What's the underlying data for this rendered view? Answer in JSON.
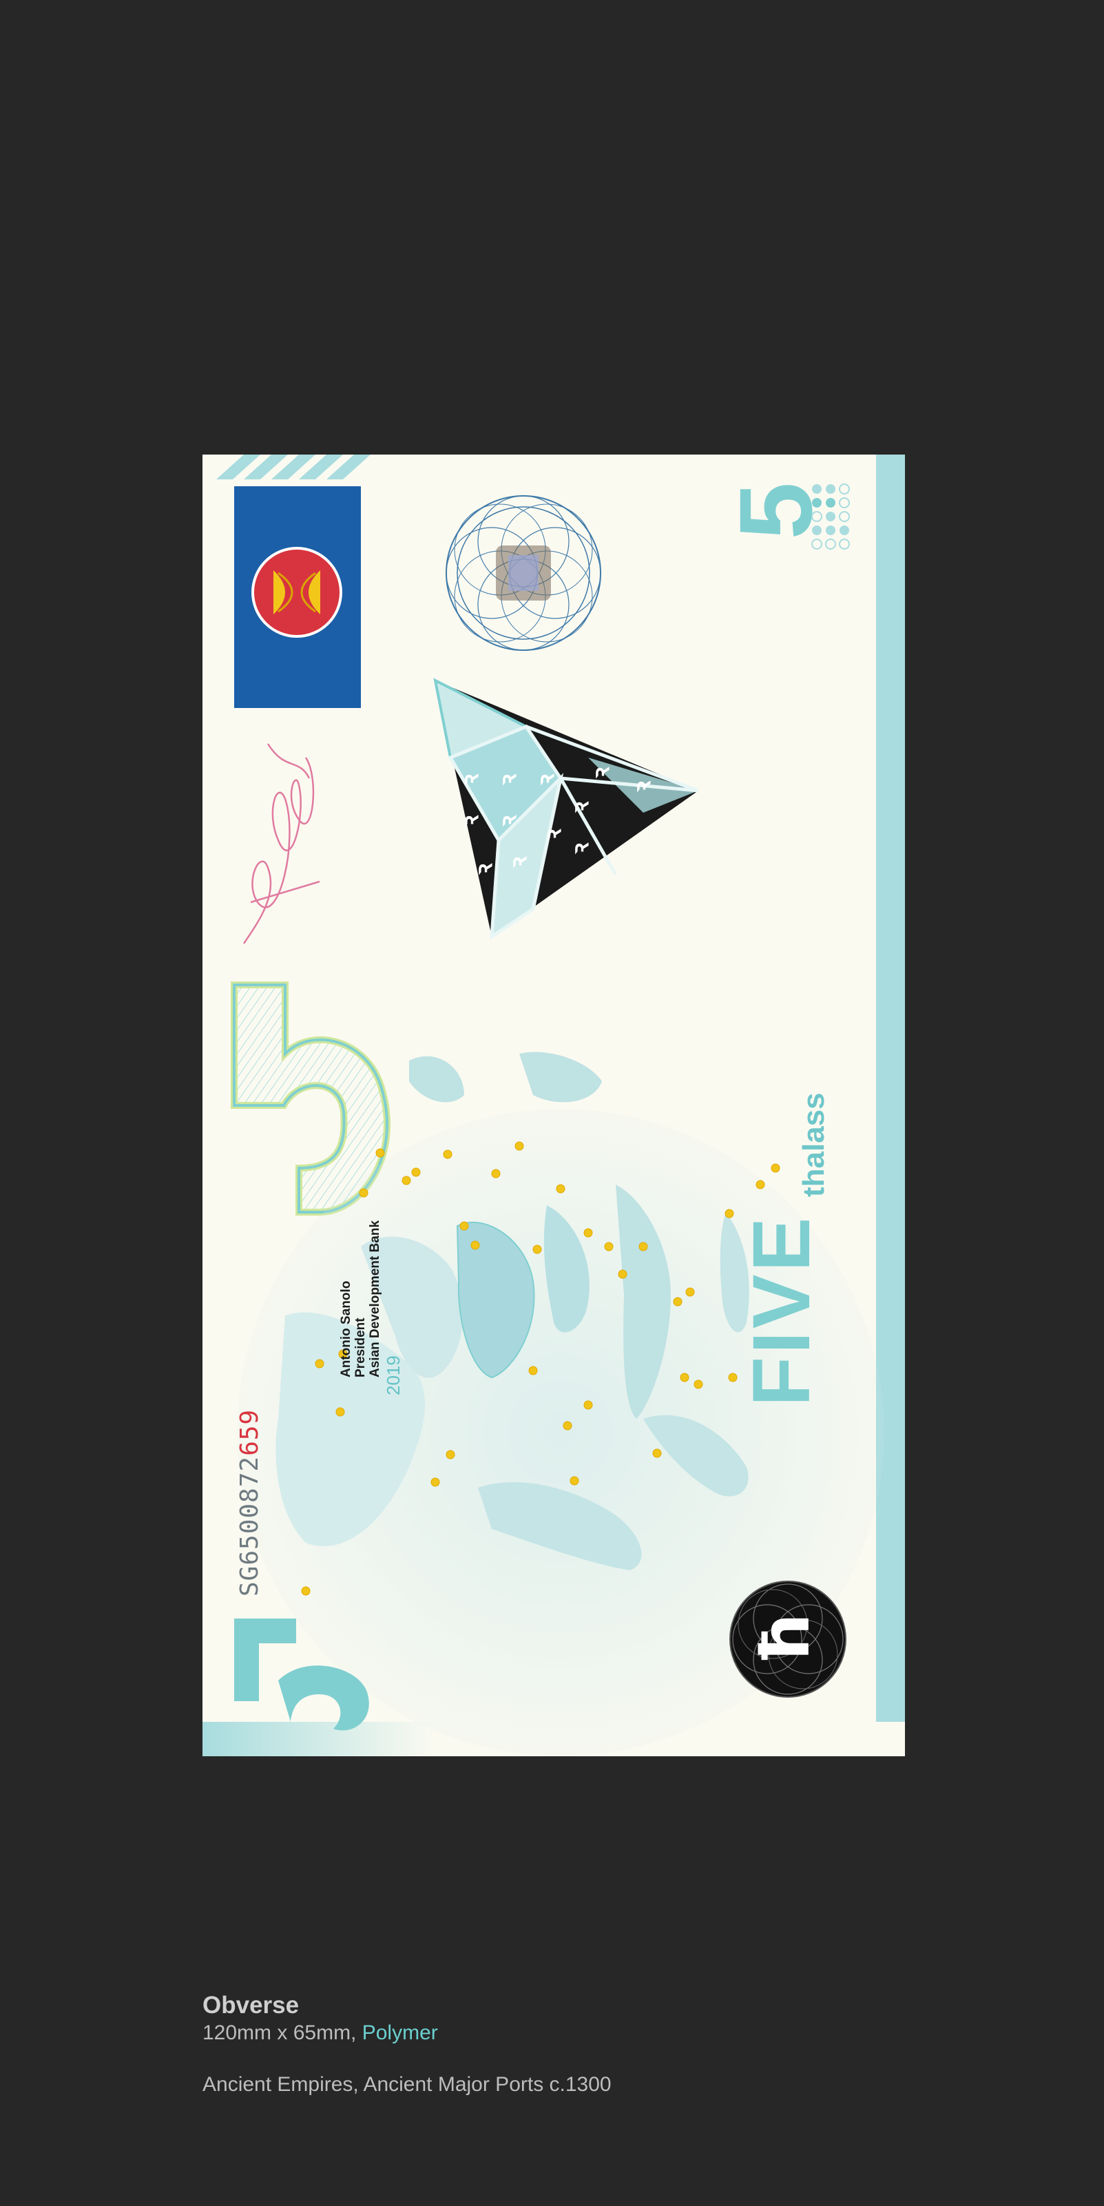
{
  "banknote": {
    "serial_prefix": "SG6500872",
    "serial_suffix": "659",
    "signatory": {
      "name": "Antonio Sanolo",
      "title": "President",
      "organization": "Asian Development Bank"
    },
    "year": "2019",
    "denomination_numeral": "5",
    "denomination_word": "FIVE",
    "currency_name": "thalass",
    "currency_symbol": "ħ",
    "triangle_glyph": "ꝛ",
    "signature_icon": "handwritten-signature",
    "emblem_icon": "asean-emblem",
    "colors": {
      "note_background": "#fbfaf1",
      "accent_teal": "#7fcfd0",
      "flag_blue": "#1b5fa8",
      "emblem_red": "#d8343f",
      "emblem_yellow": "#f2c71a",
      "port_dot": "#f0c419",
      "page_background": "#272727"
    }
  },
  "caption": {
    "title": "Obverse",
    "dimensions": "120mm x 65mm, ",
    "material": "Polymer",
    "description": "Ancient Empires, Ancient Major Ports c.1300"
  }
}
